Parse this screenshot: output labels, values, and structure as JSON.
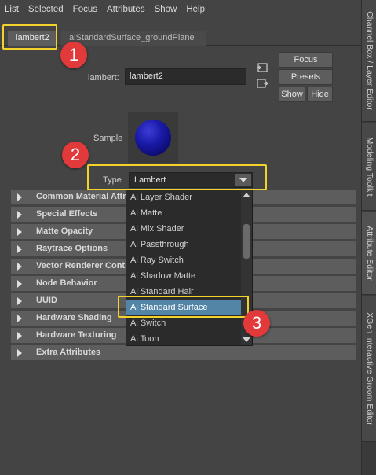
{
  "menu": [
    "List",
    "Selected",
    "Focus",
    "Attributes",
    "Show",
    "Help"
  ],
  "tabs": [
    {
      "label": "lambert2"
    },
    {
      "label": "aiStandardSurface_groundPlane"
    }
  ],
  "node": {
    "label": "lambert:",
    "value": "lambert2"
  },
  "buttons": {
    "focus": "Focus",
    "presets": "Presets",
    "show": "Show",
    "hide": "Hide"
  },
  "sample_label": "Sample",
  "type": {
    "label": "Type",
    "value": "Lambert"
  },
  "sections": [
    "Common Material Attri",
    "Special Effects",
    "Matte Opacity",
    "Raytrace Options",
    "Vector Renderer Contro",
    "Node Behavior",
    "UUID",
    "Hardware Shading",
    "Hardware Texturing",
    "Extra Attributes"
  ],
  "dropdown_items": [
    "Ai Layer Shader",
    "Ai Matte",
    "Ai Mix Shader",
    "Ai Passthrough",
    "Ai Ray Switch",
    "Ai Shadow Matte",
    "Ai Standard Hair",
    "Ai Standard Surface",
    "Ai Switch",
    "Ai Toon"
  ],
  "dropdown_selected": "Ai Standard Surface",
  "annotations": [
    "1",
    "2",
    "3"
  ],
  "side_tabs": [
    "Channel Box / Layer Editor",
    "Modeling Toolkit",
    "Attribute Editor",
    "XGen Interactive Groom Editor"
  ],
  "colors": {
    "highlight": "#f2d22b",
    "badge": "#e23a3a",
    "selection": "#5285a6"
  }
}
